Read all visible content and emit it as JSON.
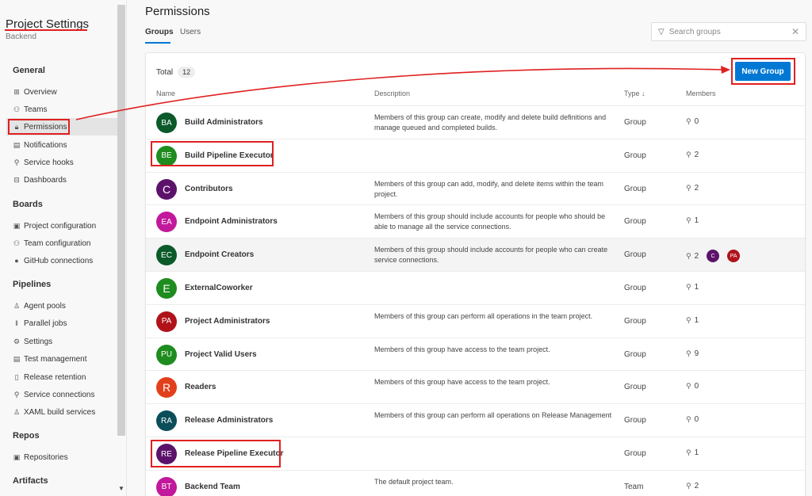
{
  "sidebar": {
    "title": "Project Settings",
    "subtitle": "Backend",
    "sections": {
      "general": "General",
      "boards": "Boards",
      "pipelines": "Pipelines",
      "repos": "Repos",
      "artifacts": "Artifacts"
    },
    "items": {
      "overview": "Overview",
      "teams": "Teams",
      "permissions": "Permissions",
      "notifications": "Notifications",
      "service_hooks": "Service hooks",
      "dashboards": "Dashboards",
      "project_configuration": "Project configuration",
      "team_configuration": "Team configuration",
      "github_connections": "GitHub connections",
      "agent_pools": "Agent pools",
      "parallel_jobs": "Parallel jobs",
      "settings": "Settings",
      "test_management": "Test management",
      "release_retention": "Release retention",
      "service_connections": "Service connections",
      "xaml_build_services": "XAML build services",
      "repositories": "Repositories"
    }
  },
  "main": {
    "title": "Permissions",
    "tabs": {
      "groups": "Groups",
      "users": "Users"
    },
    "search_placeholder": "Search groups",
    "total_label": "Total",
    "total_count": "12",
    "new_group_label": "New Group",
    "columns": {
      "name": "Name",
      "description": "Description",
      "type": "Type ↓",
      "members": "Members"
    }
  },
  "groups": [
    {
      "initials": "BA",
      "name": "Build Administrators",
      "desc": "Members of this group can create, modify and delete build definitions and manage queued and completed builds.",
      "type": "Group",
      "members": "0",
      "color": "#0b5a2a"
    },
    {
      "initials": "BE",
      "name": "Build Pipeline Executor",
      "desc": "",
      "type": "Group",
      "members": "2",
      "color": "#1e8c1e"
    },
    {
      "initials": "C",
      "name": "Contributors",
      "desc": "Members of this group can add, modify, and delete items within the team project.",
      "type": "Group",
      "members": "2",
      "color": "#5c126b"
    },
    {
      "initials": "EA",
      "name": "Endpoint Administrators",
      "desc": "Members of this group should include accounts for people who should be able to manage all the service connections.",
      "type": "Group",
      "members": "1",
      "color": "#c2189b"
    },
    {
      "initials": "EC",
      "name": "Endpoint Creators",
      "desc": "Members of this group should include accounts for people who can create service connections.",
      "type": "Group",
      "members": "2",
      "color": "#0b5a2a",
      "mini": [
        {
          "initials": "C",
          "color": "#5c126b"
        },
        {
          "initials": "PA",
          "color": "#b0121a"
        }
      ]
    },
    {
      "initials": "E",
      "name": "ExternalCoworker",
      "desc": "",
      "type": "Group",
      "members": "1",
      "color": "#1e8c1e"
    },
    {
      "initials": "PA",
      "name": "Project Administrators",
      "desc": "Members of this group can perform all operations in the team project.",
      "type": "Group",
      "members": "1",
      "color": "#b0121a"
    },
    {
      "initials": "PU",
      "name": "Project Valid Users",
      "desc": "Members of this group have access to the team project.",
      "type": "Group",
      "members": "9",
      "color": "#1e8c1e"
    },
    {
      "initials": "R",
      "name": "Readers",
      "desc": "Members of this group have access to the team project.",
      "type": "Group",
      "members": "0",
      "color": "#e2401c"
    },
    {
      "initials": "RA",
      "name": "Release Administrators",
      "desc": "Members of this group can perform all operations on Release Management",
      "type": "Group",
      "members": "0",
      "color": "#0b4e5a"
    },
    {
      "initials": "RE",
      "name": "Release Pipeline Executor",
      "desc": "",
      "type": "Group",
      "members": "1",
      "color": "#5c126b"
    },
    {
      "initials": "BT",
      "name": "Backend Team",
      "desc": "The default project team.",
      "type": "Team",
      "members": "2",
      "color": "#c2189b"
    }
  ],
  "colors": {
    "accent": "#0078d4",
    "annotation": "#e02020"
  }
}
